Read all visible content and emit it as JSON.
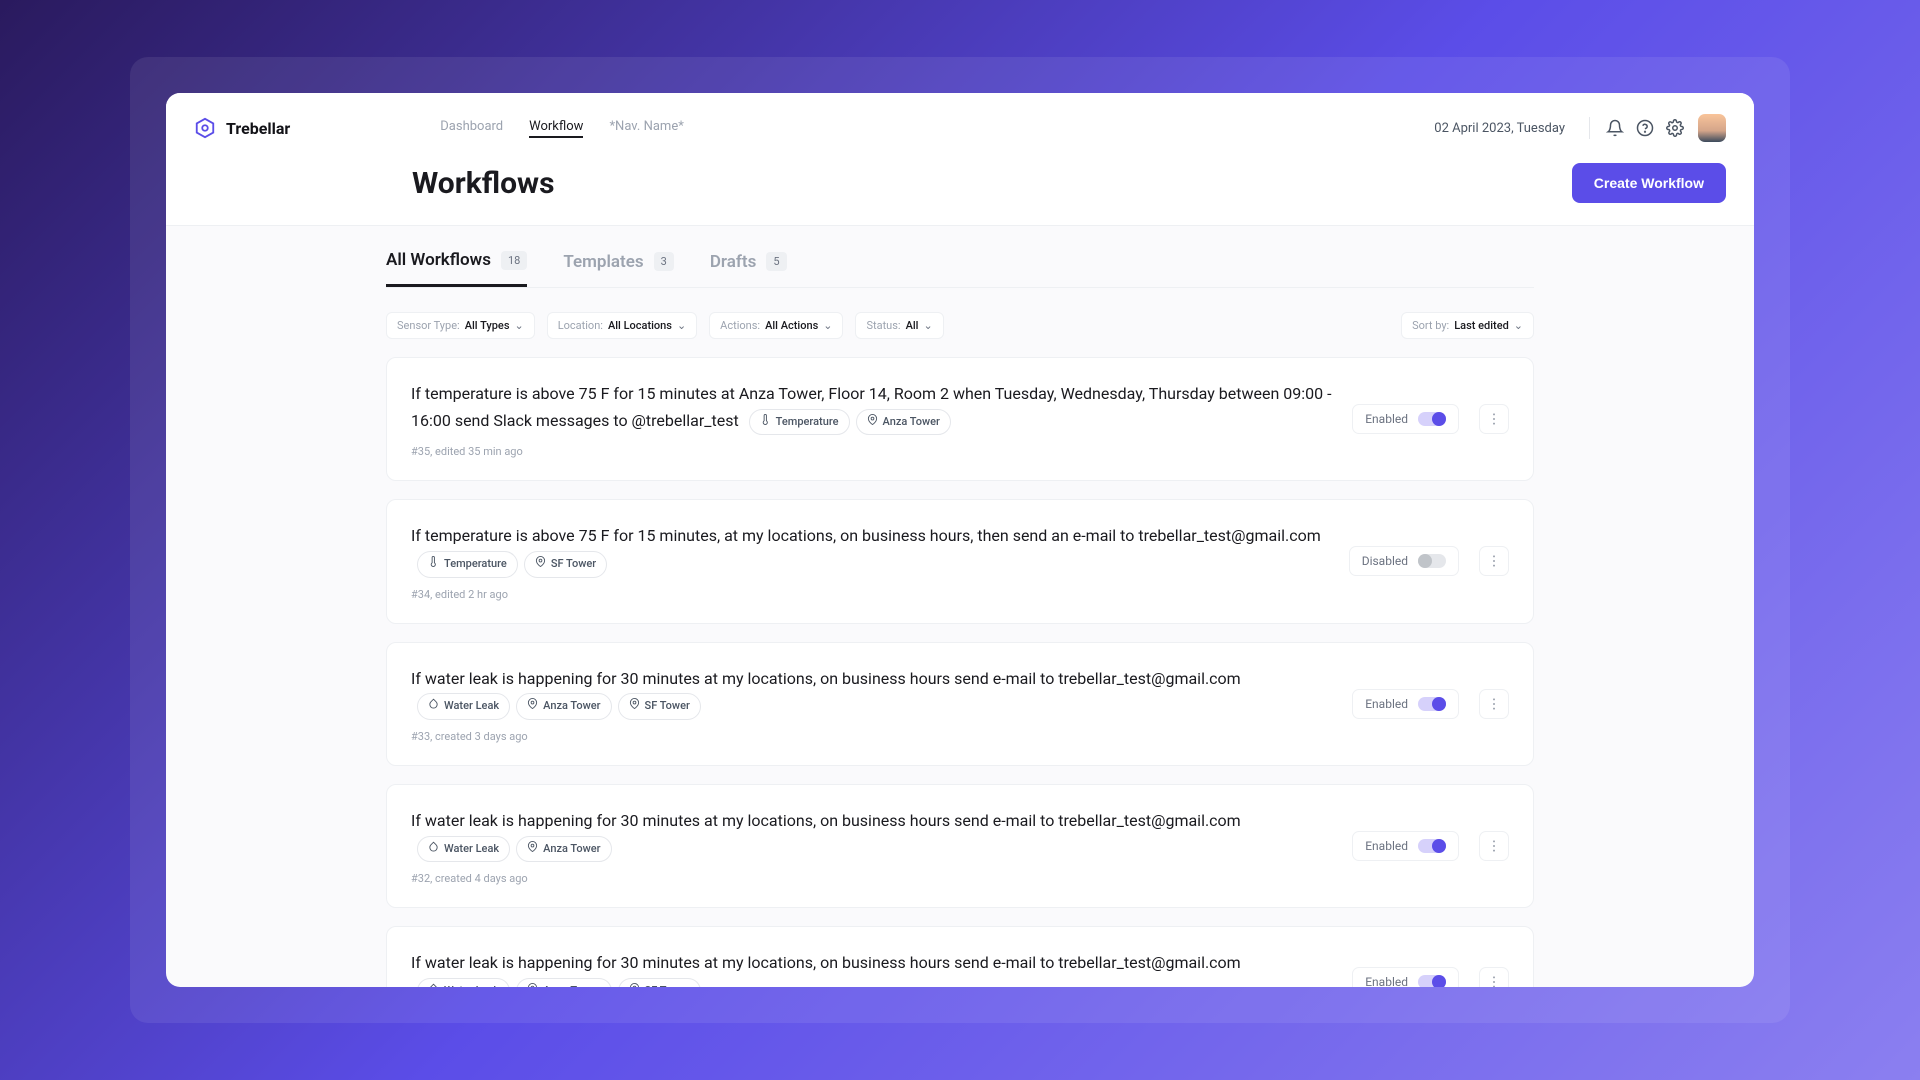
{
  "brand": {
    "name": "Trebellar"
  },
  "nav": {
    "items": [
      {
        "label": "Dashboard",
        "active": false
      },
      {
        "label": "Workflow",
        "active": true
      },
      {
        "label": "*Nav. Name*",
        "active": false
      }
    ],
    "date": "02 April 2023, Tuesday"
  },
  "page": {
    "title": "Workflows",
    "create_label": "Create Workflow"
  },
  "tabs": [
    {
      "label": "All Workflows",
      "count": "18",
      "active": true
    },
    {
      "label": "Templates",
      "count": "3",
      "active": false
    },
    {
      "label": "Drafts",
      "count": "5",
      "active": false
    }
  ],
  "filters": {
    "sensor": {
      "label": "Sensor Type:",
      "value": "All Types"
    },
    "location": {
      "label": "Location:",
      "value": "All Locations"
    },
    "actions": {
      "label": "Actions:",
      "value": "All Actions"
    },
    "status": {
      "label": "Status:",
      "value": "All"
    },
    "sort": {
      "label": "Sort by:",
      "value": "Last edited"
    }
  },
  "workflows": [
    {
      "title": "If temperature is above 75 F for 15 minutes at Anza Tower, Floor 14, Room 2 when Tuesday, Wednesday, Thursday between 09:00 - 16:00 send Slack messages to @trebellar_test",
      "tags": [
        {
          "icon": "thermometer",
          "label": "Temperature"
        },
        {
          "icon": "pin",
          "label": "Anza Tower"
        }
      ],
      "meta": "#35, edited 35 min ago",
      "enabled": true,
      "status_label": "Enabled"
    },
    {
      "title": "If temperature is above 75 F for 15 minutes, at my locations, on business hours, then send an e-mail to trebellar_test@gmail.com",
      "tags": [
        {
          "icon": "thermometer",
          "label": "Temperature"
        },
        {
          "icon": "pin",
          "label": "SF Tower"
        }
      ],
      "meta": "#34, edited 2 hr ago",
      "enabled": false,
      "status_label": "Disabled"
    },
    {
      "title": "If water leak is happening for 30 minutes at my locations, on business hours send e-mail to trebellar_test@gmail.com",
      "tags": [
        {
          "icon": "drop",
          "label": "Water Leak"
        },
        {
          "icon": "pin",
          "label": "Anza Tower"
        },
        {
          "icon": "pin",
          "label": "SF Tower"
        }
      ],
      "meta": "#33, created 3 days ago",
      "enabled": true,
      "status_label": "Enabled"
    },
    {
      "title": "If water leak is happening for 30 minutes at my locations, on business hours send e-mail to trebellar_test@gmail.com",
      "tags": [
        {
          "icon": "drop",
          "label": "Water Leak"
        },
        {
          "icon": "pin",
          "label": "Anza Tower"
        }
      ],
      "meta": "#32, created 4 days ago",
      "enabled": true,
      "status_label": "Enabled"
    },
    {
      "title": "If water leak is happening for 30 minutes at my locations, on business hours send e-mail to trebellar_test@gmail.com",
      "tags": [
        {
          "icon": "drop",
          "label": "Water Leak"
        },
        {
          "icon": "pin",
          "label": "Anza Tower"
        },
        {
          "icon": "pin",
          "label": "SF Tower"
        }
      ],
      "meta": "",
      "enabled": true,
      "status_label": "Enabled"
    }
  ],
  "colors": {
    "accent": "#5b4de8"
  }
}
